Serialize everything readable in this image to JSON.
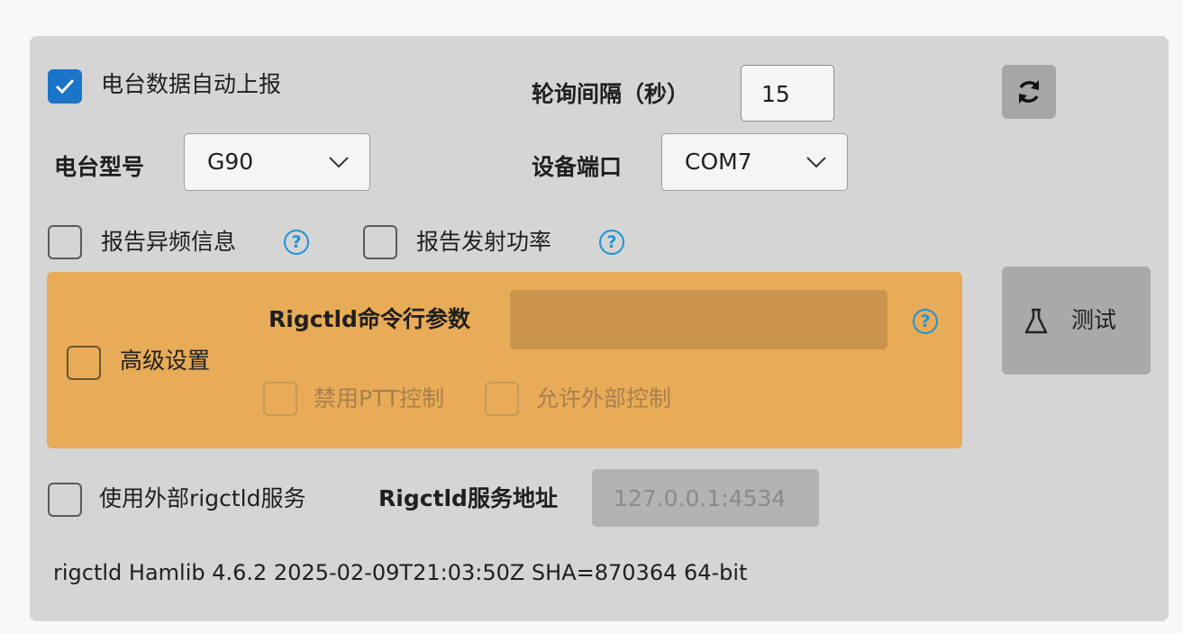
{
  "auto_report": {
    "label": "电台数据自动上报",
    "checked": true
  },
  "poll_interval": {
    "label": "轮询间隔（秒）",
    "value": "15"
  },
  "refresh_icon": "refresh-icon",
  "radio_model": {
    "label": "电台型号",
    "value": "G90"
  },
  "device_port": {
    "label": "设备端口",
    "value": "COM7"
  },
  "report_offfreq": {
    "label": "报告异频信息",
    "checked": false,
    "help": "?"
  },
  "report_power": {
    "label": "报告发射功率",
    "checked": false,
    "help": "?"
  },
  "advanced": {
    "label": "高级设置",
    "checked": false,
    "rigctld_args_label": "Rigctld命令行参数",
    "rigctld_args_value": "",
    "help": "?",
    "disable_ptt": {
      "label": "禁用PTT控制",
      "checked": false
    },
    "allow_external": {
      "label": "允许外部控制",
      "checked": false
    },
    "accent_color": "#e8ab57"
  },
  "test_button": {
    "label": "测试",
    "icon": "flask-icon"
  },
  "external_service": {
    "label": "使用外部rigctld服务",
    "checked": false
  },
  "service_address": {
    "label": "Rigctld服务地址",
    "placeholder": "127.0.0.1:4534"
  },
  "version_text": "rigctld Hamlib 4.6.2 2025-02-09T21:03:50Z SHA=870364 64-bit",
  "colors": {
    "checkbox_checked": "#1a74c7",
    "help_icon": "#1e93d6",
    "panel_bg": "#d5d5d5"
  }
}
